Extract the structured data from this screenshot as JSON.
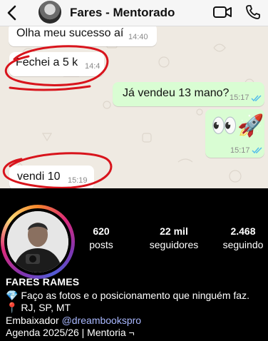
{
  "header": {
    "title": "Fares - Mentorado",
    "back_icon": "chevron-left-icon",
    "video_icon": "video-camera-icon",
    "phone_icon": "phone-icon"
  },
  "messages": [
    {
      "direction": "in",
      "text": "Olha meu sucesso aí",
      "time": "14:40"
    },
    {
      "direction": "in",
      "text": "Fechei a 5 k",
      "time": "14:4",
      "annotated": true
    },
    {
      "direction": "out",
      "text": "Já vendeu 13 mano?",
      "time": "15:17",
      "read": true
    },
    {
      "direction": "out",
      "text": "👀🚀",
      "time": "15:17",
      "read": true
    },
    {
      "direction": "in",
      "text": "vendi 10",
      "time": "15:19",
      "annotated": true
    }
  ],
  "profile": {
    "name": "FARES RAMES",
    "stats": [
      {
        "value": "620",
        "label": "posts"
      },
      {
        "value": "22 mil",
        "label": "seguidores"
      },
      {
        "value": "2.468",
        "label": "seguindo"
      }
    ],
    "bio": {
      "line1": "💎 Faço as fotos e o posicionamento que ninguém faz.",
      "line2": "📍 RJ, SP, MT",
      "line3_prefix": "Embaixador ",
      "line3_link": "@dreambookspro",
      "line4": "Agenda 2025/26 | Mentoria ¬"
    }
  },
  "colors": {
    "chat_bg": "#efeae2",
    "outgoing_bubble": "#d9fdd3",
    "incoming_bubble": "#ffffff",
    "annotation": "#d8141c",
    "read_ticks": "#53bdeb",
    "profile_bg": "#000000"
  }
}
